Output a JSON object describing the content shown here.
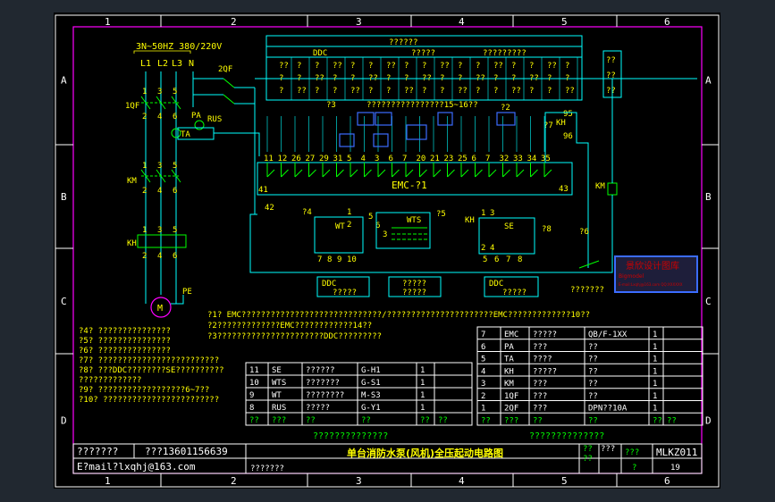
{
  "colors": {
    "background": "#212830",
    "paper": "#000000",
    "frame": "#ffffff",
    "border_line": "#ff00ff",
    "wire_cyan": "#00ffff",
    "component_green": "#00ff00",
    "label_yellow": "#ffff00",
    "bus_blue": "#3b6cff",
    "stamp_red": "#cc0000"
  },
  "grid": {
    "columns": [
      "1",
      "2",
      "3",
      "4",
      "5",
      "6"
    ],
    "rows": [
      "A",
      "B",
      "C",
      "D"
    ]
  },
  "supply": {
    "spec": "3N~50HZ 380/220V",
    "phases": [
      "L1",
      "L2",
      "L3",
      "N"
    ]
  },
  "components": {
    "qf1": "1QF",
    "qf2": "2QF",
    "pa": "PA",
    "rus": "RUS",
    "ta": "TA",
    "km": "KM",
    "kh": "KH",
    "motor": "M",
    "pe": "PE",
    "km_coil": "KM",
    "kh_contact": "KH",
    "kh_nums": [
      "95",
      "96"
    ],
    "emc_block": "EMC-?1",
    "wt": "WT",
    "wts": "WTS",
    "se": "SE",
    "ddc_left": "DDC",
    "ddc_right": "DDC",
    "box_mid": "?????",
    "box_left_sub": "?????",
    "box_right_sub": "?????",
    "box_mid_sub": "?????",
    "q_label_4": "?4",
    "q_label_5": "?5",
    "q_label_6": "?6",
    "q_label_7": "?7",
    "q_label_8": "?8",
    "q_label_2": "?2",
    "kh_side": "KH",
    "emc_in_left": "41",
    "emc_in_left2": "42",
    "emc_in_right": "43",
    "pole_nums_top": [
      "1",
      "3",
      "5"
    ],
    "pole_nums_bottom": [
      "2",
      "4",
      "6"
    ]
  },
  "terminals": [
    "11",
    "12",
    "26",
    "27",
    "29",
    "31",
    "5",
    "4",
    "3",
    "6",
    "7",
    "20",
    "21",
    "23",
    "25",
    "6",
    "7",
    "32",
    "33",
    "34",
    "35"
  ],
  "sub_terminals": {
    "wt": [
      "1",
      "2",
      "7",
      "8",
      "9",
      "10"
    ],
    "wts": [
      "5",
      "6",
      "3"
    ],
    "se": [
      "1",
      "3",
      "2",
      "4",
      "5",
      "6",
      "7",
      "8"
    ]
  },
  "top_table": {
    "header": "??????",
    "ddc": "DDC",
    "mid": "?????",
    "right": "?????????",
    "cell": "?",
    "pair": "??",
    "bottom": "?3",
    "bottom_mid": "????????????????15~16??"
  },
  "right_box": [
    "??",
    "??",
    "??"
  ],
  "stamp": {
    "title": "景欣设计图库",
    "line2": "Bigmodel",
    "line3": "E-mail:Lxqhj@163.com QQ:XXXXXX"
  },
  "stamp_caption": "???????",
  "notes_right": [
    "?1? EMC?????????????????????????????/??????????????????????EMC?????????????10??",
    "?2?????????????EMC????????????14??",
    "?3??????????????????????DDC?????????"
  ],
  "notes_left": [
    "?4? ???????????????",
    "?5? ???????????????",
    "?6? ???????????????",
    "?7? ?????????????????????????",
    "?8? ???DDC????????SE??????????",
    "    ?????????????",
    "?9? ??????????????????6~7??",
    "?10? ????????????????????????"
  ],
  "bom_left": {
    "rows": [
      {
        "no": "11",
        "code": "SE",
        "name": "??????",
        "model": "G-H1",
        "qty": "1",
        "note": ""
      },
      {
        "no": "10",
        "code": "WTS",
        "name": "???????",
        "model": "G-S1",
        "qty": "1",
        "note": ""
      },
      {
        "no": "9",
        "code": "WT",
        "name": "????????",
        "model": "M-S3",
        "qty": "1",
        "note": ""
      },
      {
        "no": "8",
        "code": "RUS",
        "name": "?????",
        "model": "G-Y1",
        "qty": "1",
        "note": ""
      }
    ],
    "header": {
      "no": "??",
      "code": "???",
      "name": "??",
      "model": "??",
      "qty": "??",
      "note": "??"
    }
  },
  "bom_right": {
    "rows": [
      {
        "no": "7",
        "code": "EMC",
        "name": "?????",
        "model": "QB/F-1XX",
        "qty": "1"
      },
      {
        "no": "6",
        "code": "PA",
        "name": "???",
        "model": "??",
        "qty": "1"
      },
      {
        "no": "5",
        "code": "TA",
        "name": "????",
        "model": "??",
        "qty": "1"
      },
      {
        "no": "4",
        "code": "KH",
        "name": "?????",
        "model": "??",
        "qty": "1"
      },
      {
        "no": "3",
        "code": "KM",
        "name": "???",
        "model": "??",
        "qty": "1"
      },
      {
        "no": "2",
        "code": "1QF",
        "name": "???",
        "model": "??",
        "qty": "1"
      },
      {
        "no": "1",
        "code": "2QF",
        "name": "???",
        "model": "DPN??10A",
        "qty": "1"
      }
    ],
    "header": {
      "no": "??",
      "code": "???",
      "name": "??",
      "model": "??",
      "qty": "??",
      "note": "??"
    }
  },
  "bom_caption": "??????????????",
  "title_block": {
    "design": "???????",
    "phone": "???13601156639",
    "email": "E?mail?lxqhj@163.com",
    "check": "???????",
    "drawing_title": "单台消防水泵(风机)全压起动电路图",
    "col_a1": "??",
    "col_a2": "??",
    "col_b": "???",
    "col_c1": "???",
    "col_d1": "?",
    "drawing_no": "MLKZ011",
    "page": "19"
  }
}
